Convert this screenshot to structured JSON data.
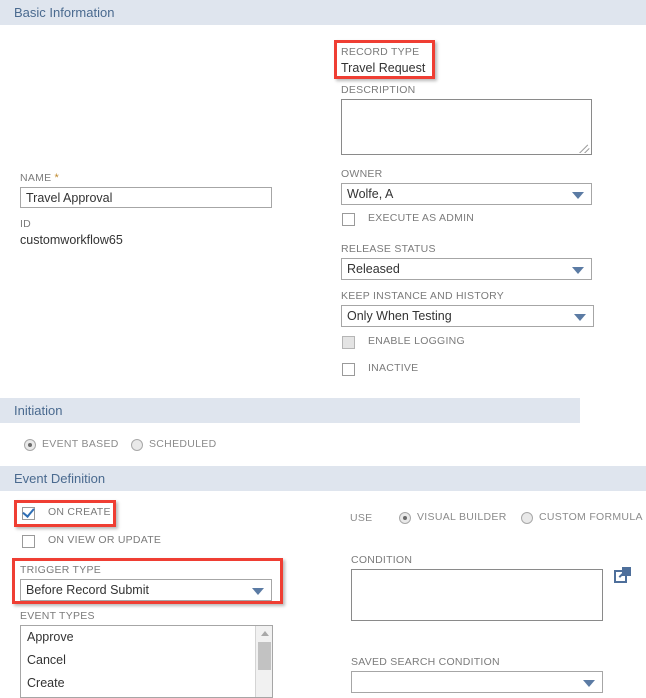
{
  "sections": {
    "basic_information": "Basic Information",
    "initiation": "Initiation",
    "event_definition": "Event Definition"
  },
  "basic": {
    "record_type": {
      "label": "RECORD TYPE",
      "value": "Travel Request"
    },
    "description": {
      "label": "DESCRIPTION",
      "value": "",
      "placeholder": ""
    },
    "owner": {
      "label": "OWNER",
      "value": "Wolfe, A"
    },
    "execute_as_admin": {
      "label": "EXECUTE AS ADMIN",
      "checked": false,
      "disabled": true
    },
    "release_status": {
      "label": "RELEASE STATUS",
      "value": "Released"
    },
    "keep_instance_and_history": {
      "label": "KEEP INSTANCE AND HISTORY",
      "value": "Only When Testing"
    },
    "enable_logging": {
      "label": "ENABLE LOGGING",
      "checked": false,
      "disabled": true
    },
    "inactive": {
      "label": "INACTIVE",
      "checked": false,
      "disabled": false
    },
    "name": {
      "label": "NAME",
      "required_marker": "*",
      "value": "Travel Approval",
      "placeholder": ""
    },
    "id": {
      "label": "ID",
      "value": "customworkflow65"
    }
  },
  "initiation": {
    "event_based": {
      "label": "EVENT BASED",
      "selected": true
    },
    "scheduled": {
      "label": "SCHEDULED",
      "selected": false
    }
  },
  "event_definition": {
    "on_create": {
      "label": "ON CREATE",
      "checked": true
    },
    "on_view_or_update": {
      "label": "ON VIEW OR UPDATE",
      "checked": false
    },
    "trigger_type": {
      "label": "TRIGGER TYPE",
      "value": "Before Record Submit"
    },
    "event_types": {
      "label": "EVENT TYPES",
      "items": [
        "Approve",
        "Cancel",
        "Create"
      ]
    },
    "use": {
      "label": "USE",
      "options": [
        {
          "label": "VISUAL BUILDER",
          "selected": true
        },
        {
          "label": "CUSTOM FORMULA",
          "selected": false
        }
      ]
    },
    "condition": {
      "label": "CONDITION",
      "value": ""
    },
    "saved_search_condition": {
      "label": "SAVED SEARCH CONDITION",
      "value": ""
    }
  },
  "icons": {
    "dropdown_arrow": "chevron-down-icon",
    "open_external": "external-link-icon",
    "scroll_up": "scroll-up-arrow-icon",
    "resize_grip": "resize-grip-icon"
  },
  "colors": {
    "section_header_bg": "#dfe5ee",
    "section_header_text": "#4a6a8f",
    "annotation_red": "#ef3e33",
    "accent_blue": "#4e6f9b",
    "label_gray": "#7b7b7b"
  }
}
